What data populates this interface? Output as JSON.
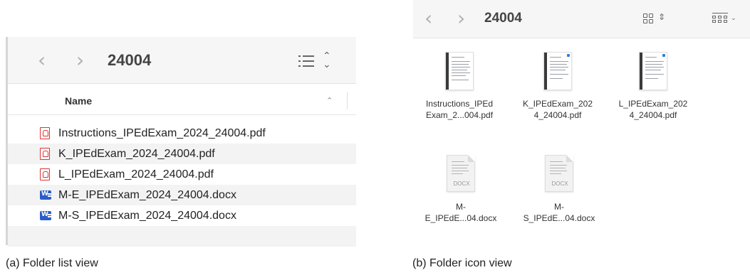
{
  "list_view": {
    "title": "24004",
    "column_header": "Name",
    "files": [
      {
        "name": "Instructions_IPEdExam_2024_24004.pdf",
        "icon": "pdf-icon"
      },
      {
        "name": "K_IPEdExam_2024_24004.pdf",
        "icon": "pdf-icon"
      },
      {
        "name": "L_IPEdExam_2024_24004.pdf",
        "icon": "pdf-icon"
      },
      {
        "name": "M-E_IPEdExam_2024_24004.docx",
        "icon": "word-icon"
      },
      {
        "name": "M-S_IPEdExam_2024_24004.docx",
        "icon": "word-icon"
      }
    ]
  },
  "icon_view": {
    "title": "24004",
    "files": [
      {
        "line1": "Instructions_IPEd",
        "line2": "Exam_2...004.pdf",
        "type": "pdf"
      },
      {
        "line1": "K_IPEdExam_202",
        "line2": "4_24004.pdf",
        "type": "pdf"
      },
      {
        "line1": "L_IPEdExam_202",
        "line2": "4_24004.pdf",
        "type": "pdf"
      },
      {
        "line1": "M-",
        "line2": "E_IPEdE...04.docx",
        "type": "docx",
        "ext": "DOCX"
      },
      {
        "line1": "M-",
        "line2": "S_IPEdE...04.docx",
        "type": "docx",
        "ext": "DOCX"
      }
    ]
  },
  "captions": {
    "a": "(a) Folder list view",
    "b": "(b) Folder icon view"
  },
  "colors": {
    "toolbar_bg": "#f6f6f6",
    "pdf_red": "#d33333",
    "word_blue": "#2b5cc7"
  }
}
